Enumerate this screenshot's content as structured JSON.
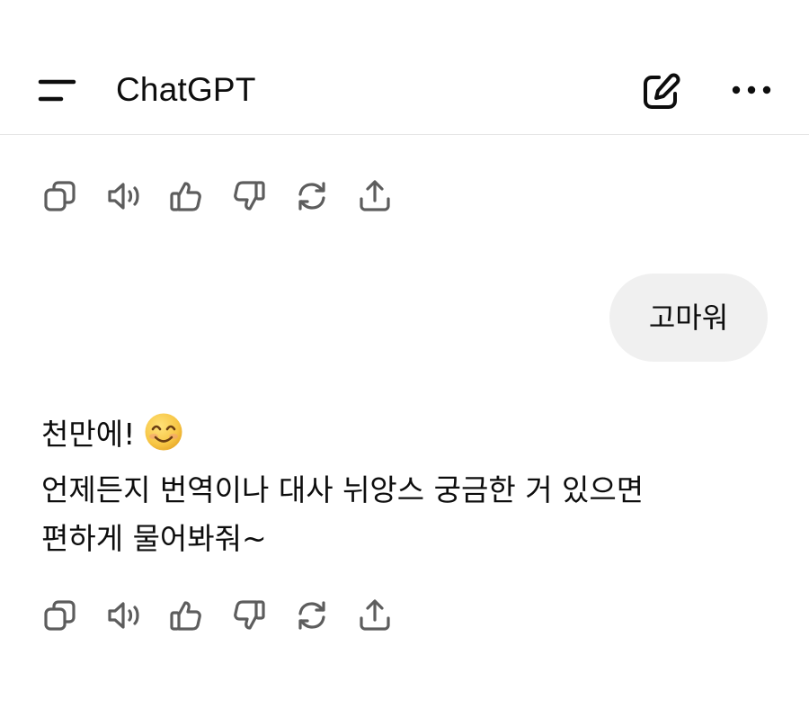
{
  "header": {
    "title": "ChatGPT",
    "menu_icon": "menu-icon",
    "new_chat_icon": "edit-icon",
    "more_icon": "more-horizontal-icon"
  },
  "actions": [
    {
      "name": "copy",
      "icon": "copy-icon"
    },
    {
      "name": "read-aloud",
      "icon": "speaker-icon"
    },
    {
      "name": "good-response",
      "icon": "thumbs-up-icon"
    },
    {
      "name": "bad-response",
      "icon": "thumbs-down-icon"
    },
    {
      "name": "regenerate",
      "icon": "refresh-icon"
    },
    {
      "name": "share",
      "icon": "share-icon"
    }
  ],
  "conversation": {
    "user_message": "고마워",
    "assistant_message": {
      "line1": "천만에!",
      "line1_emoji": "smiling-face-emoji",
      "line2": "언제든지 번역이나 대사 뉘앙스 궁금한 거 있으면",
      "line3": "편하게 물어봐줘~"
    }
  },
  "colors": {
    "background": "#ffffff",
    "text": "#0d0d0d",
    "bubble": "#f0f0f0",
    "divider": "#e6e6e6",
    "icon": "#5d5d5d",
    "emoji_face": "#f7c645"
  }
}
